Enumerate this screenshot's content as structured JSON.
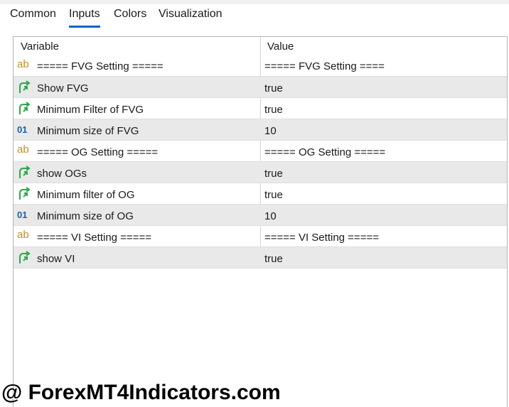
{
  "tabs": [
    {
      "label": "Common"
    },
    {
      "label": "Inputs"
    },
    {
      "label": "Colors"
    },
    {
      "label": "Visualization"
    }
  ],
  "active_tab": "Inputs",
  "table": {
    "headers": {
      "variable": "Variable",
      "value": "Value"
    },
    "rows": [
      {
        "icon": "string-type-icon",
        "name": "===== FVG Setting =====",
        "value": "===== FVG Setting ===="
      },
      {
        "icon": "bool-type-icon",
        "name": "Show FVG",
        "value": "true"
      },
      {
        "icon": "bool-type-icon",
        "name": "Minimum Filter of FVG",
        "value": "true"
      },
      {
        "icon": "int-type-icon",
        "name": "Minimum size of FVG",
        "value": "10"
      },
      {
        "icon": "string-type-icon",
        "name": "===== OG Setting =====",
        "value": "===== OG Setting ====="
      },
      {
        "icon": "bool-type-icon",
        "name": "show OGs",
        "value": "true"
      },
      {
        "icon": "bool-type-icon",
        "name": "Minimum filter of OG",
        "value": "true"
      },
      {
        "icon": "int-type-icon",
        "name": "Minimum size of OG",
        "value": "10"
      },
      {
        "icon": "string-type-icon",
        "name": "===== VI Setting =====",
        "value": "===== VI Setting ====="
      },
      {
        "icon": "bool-type-icon",
        "name": "show VI",
        "value": "true"
      }
    ]
  },
  "icon_glyphs": {
    "string": "ab",
    "int": "01"
  },
  "watermark": "@ ForexMT4Indicators.com",
  "colors": {
    "active_tab_underline": "#0a64c8",
    "bool_icon": "#2aa84a",
    "string_icon": "#c09028",
    "int_icon": "#1f5fa8",
    "alt_row": "#e9e9e9"
  }
}
